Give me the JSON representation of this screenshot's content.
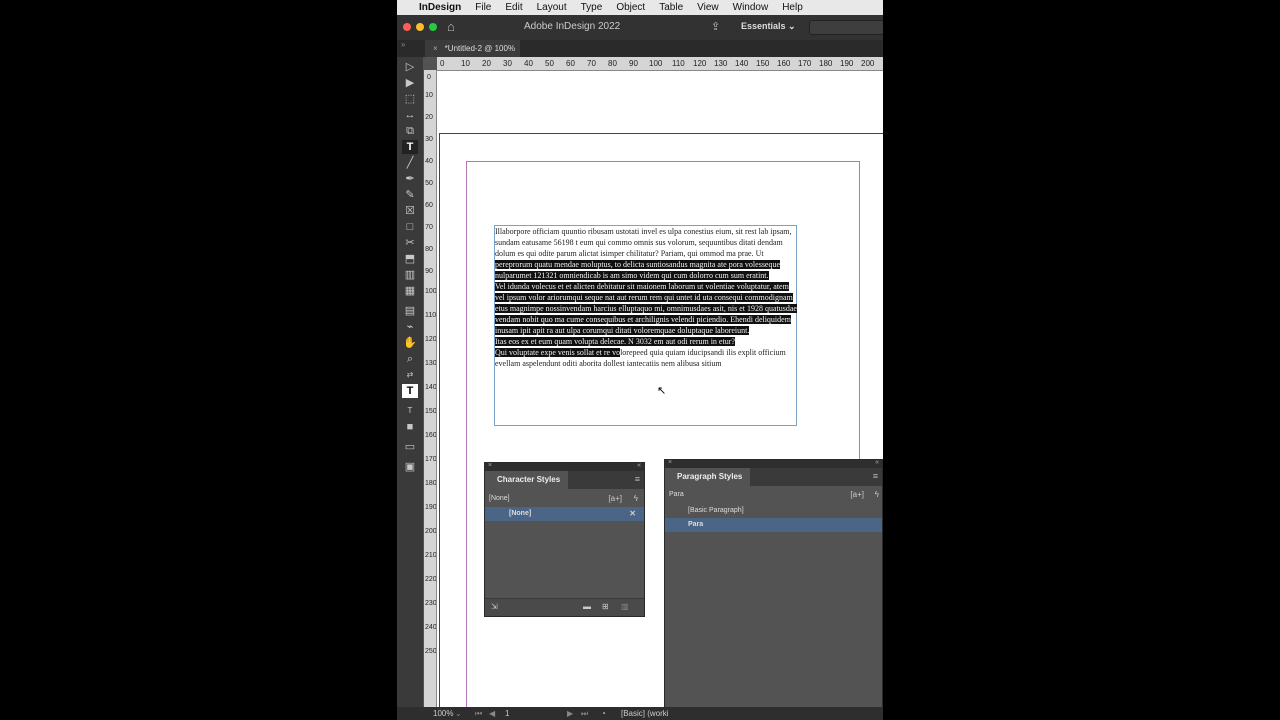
{
  "menubar": {
    "app": "InDesign",
    "items": [
      "File",
      "Edit",
      "Layout",
      "Type",
      "Object",
      "Table",
      "View",
      "Window",
      "Help"
    ]
  },
  "titlebar": {
    "title": "Adobe InDesign 2022",
    "workspace": "Essentials"
  },
  "document": {
    "tab_label": "*Untitled-2 @ 100%"
  },
  "ruler": {
    "h_labels": [
      "0",
      "10",
      "20",
      "30",
      "40",
      "50",
      "60",
      "70",
      "80",
      "90",
      "100",
      "110",
      "120",
      "130",
      "140",
      "150",
      "160",
      "170",
      "180",
      "190",
      "200"
    ],
    "v_labels": [
      "0",
      "10",
      "20",
      "30",
      "40",
      "50",
      "60",
      "70",
      "80",
      "90",
      "100",
      "110",
      "120",
      "130",
      "140",
      "150",
      "160",
      "170",
      "180",
      "190",
      "200",
      "210",
      "220",
      "230",
      "240",
      "250"
    ]
  },
  "story": {
    "p1_a": "Illaborpore officiam quuntio ribusam ustotati invel es ulpa conestius eium, sit rest lab ipsam, sundam eatusame 56198 t eum qui commo omnis sus volorum, sequuntibus ditati dendam dolum es qui odite parum alictat isimper chilitatur? Pariam, qui ommod ma prae. Ut",
    "p1_b": " pereprorum quatu mendae moluptus, to delicta suntiosandus magnita ate pora volesseque nulparumet 121321 omniendicab is am simo videm qui cum dolorro cum sum eratint.",
    "p2": "Vel idunda volecus et et alicten debitatur sit maionem laborum ut volentiae voluptatur, atem vel ipsum volor ariorumqui seque nat aut rerum rem qui untet id uta consequi commodignam etus magnimpe nossinvendam harcius elluptaquo mi, omnimusdaes asit, nis et 1928 quatusdae vendam nobit quo ma cume consequibus et archilignis velendi piciendio. Ehendi deliquidem inusam ipit apit ra aut ulpa corumqui ditati voloremquae doluptaque laboreiunt.",
    "p3": "Itas eos ex et eum quam volupta delecae. N 3032 em aut odi rerum in etur?",
    "p4_a": "Qui voluptate expe venis sollat et re vo",
    "p4_b": "lorepeed quia quiam iducipsandi ilis explit officium evellam aspelendunt oditi aborita dollest iantecatiis nem alibusa sitium"
  },
  "statusbar": {
    "zoom": "100%",
    "page": "1",
    "preflight": "[Basic] (worki"
  },
  "char_styles": {
    "title": "Character Styles",
    "current": "[None]",
    "items": [
      "[None]"
    ]
  },
  "para_styles": {
    "title": "Paragraph Styles",
    "current": "Para",
    "items": [
      "[Basic Paragraph]",
      "Para"
    ]
  },
  "colors": {
    "ui_bg": "#535353",
    "selection": "#4b6587",
    "text_highlight": "#111111",
    "margin_guide": "#b27ab4",
    "frame_edge": "#7aa2c8"
  },
  "icons": {
    "tools": [
      "selection-tool-icon",
      "direct-selection-tool-icon",
      "page-tool-icon",
      "gap-tool-icon",
      "content-collector-icon",
      "type-tool-icon",
      "line-tool-icon",
      "pen-tool-icon",
      "pencil-tool-icon",
      "rectangle-frame-tool-icon",
      "rectangle-tool-icon",
      "scissors-tool-icon",
      "free-transform-tool-icon",
      "gradient-swatch-tool-icon",
      "gradient-feather-tool-icon",
      "note-tool-icon",
      "eyedropper-tool-icon",
      "hand-tool-icon",
      "zoom-tool-icon"
    ]
  }
}
